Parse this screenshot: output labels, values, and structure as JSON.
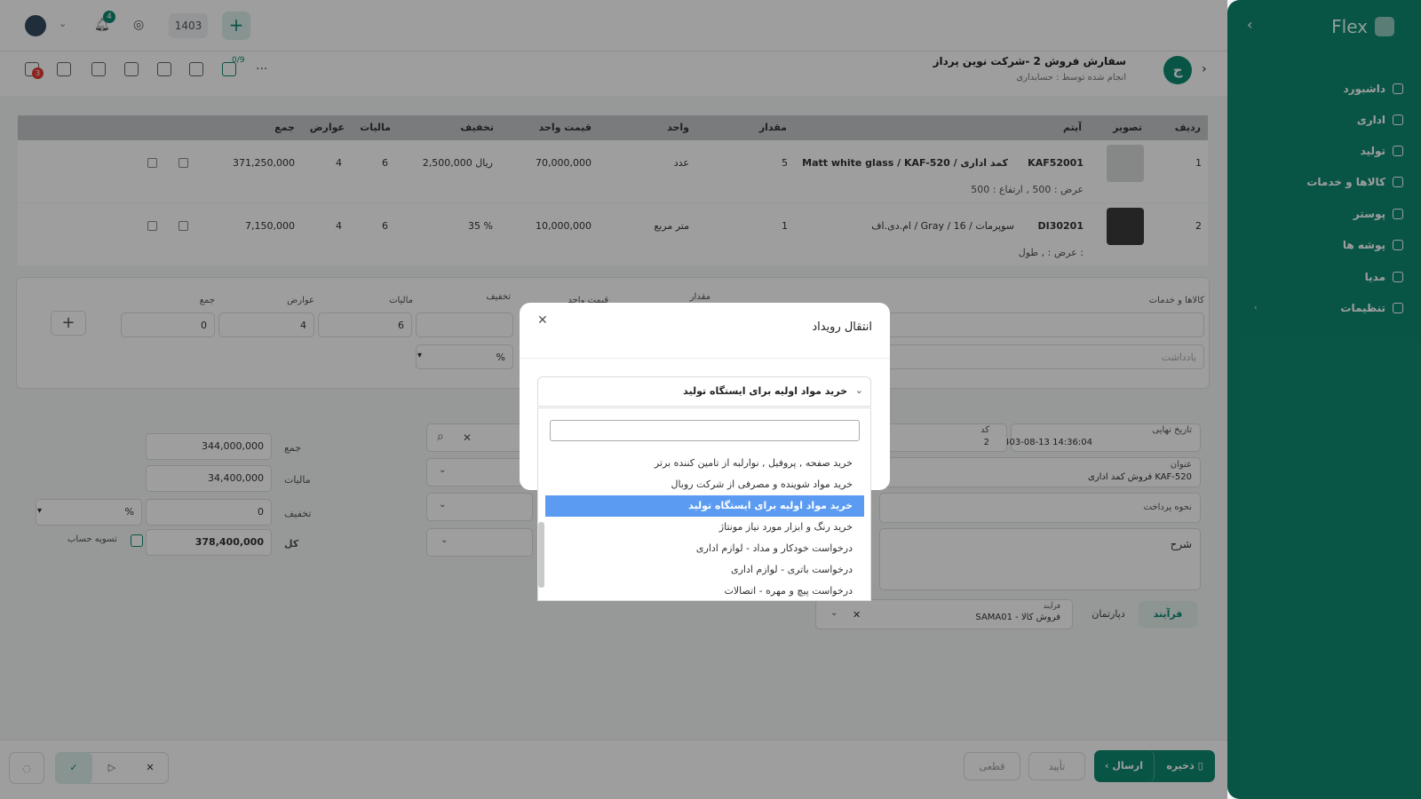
{
  "sidebar": {
    "logo": "Flex",
    "items": [
      {
        "label": "داشبورد"
      },
      {
        "label": "اداری"
      },
      {
        "label": "تولید"
      },
      {
        "label": "کالاها و خدمات"
      },
      {
        "label": "پوستر"
      },
      {
        "label": "پوشه ها"
      },
      {
        "label": "مدیا"
      },
      {
        "label": "تنظیمات"
      }
    ]
  },
  "topbar": {
    "notifications_count": "4",
    "year": "1403"
  },
  "header": {
    "title": "سفارش فروش 2 -شرکت نوین پرداز",
    "subtitle": "انجام شده توسط : حسابداری",
    "avatar_letter": "ج",
    "tool_badge": "3",
    "tool_count": "0/9"
  },
  "table": {
    "headers": {
      "row": "ردیف",
      "image": "تصویر",
      "item": "آیتم",
      "qty": "مقدار",
      "unit": "واحد",
      "unit_price": "قیمت واحد",
      "discount": "تخفیف",
      "tax": "مالیات",
      "duties": "عوارض",
      "total": "جمع"
    },
    "rows": [
      {
        "row": "1",
        "code": "KAF52001",
        "name": "Matt white glass / KAF-520 / کمد اداری",
        "dims": "عرض : 500 ,  ارتفاع : 500",
        "qty": "5",
        "unit": "عدد",
        "unit_price": "70,000,000",
        "discount": "2,500,000 ریال",
        "tax": "6",
        "duties": "4",
        "total": "371,250,000"
      },
      {
        "row": "2",
        "code": "DI30201",
        "name": "ام.دی.اف / Gray / 16 / سوپرمات",
        "dims": "عرض : ,  طول :",
        "qty": "1",
        "unit": "متر مربع",
        "unit_price": "10,000,000",
        "discount": "35 %",
        "tax": "6",
        "duties": "4",
        "total": "7,150,000"
      }
    ]
  },
  "entry": {
    "goods_label": "کالاها و خدمات",
    "qty_label": "مقدار",
    "unit_price_label": "قیمت واحد",
    "discount_label": "تخفیف",
    "tax_label": "مالیات",
    "duties_label": "عوارض",
    "total_label": "جمع",
    "tax_value": "6",
    "duties_value": "4",
    "total_value": "0",
    "percent": "%",
    "note_placeholder": "یادداشت"
  },
  "summary": {
    "sum_label": "جمع",
    "sum_value": "344,000,000",
    "tax_label": "مالیات",
    "tax_value": "34,400,000",
    "discount_label": "تخفیف",
    "discount_value": "0",
    "percent": "%",
    "total_label": "کل",
    "total_value": "378,400,000",
    "settle_label": "تسویه حساب"
  },
  "details": {
    "deadline_label": "تاریخ نهایی",
    "deadline_value": "1403-08-13 14:36:04",
    "code_label": "کد",
    "code_value": "2",
    "title_label": "عنوان",
    "title_value": "فروش کمد اداری KAF-520",
    "payment_label": "نحوه پرداخت",
    "description_label": "شرح",
    "process_tab": "فرآیند",
    "department_tab": "دپارتمان",
    "process_field_label": "فرآیند",
    "process_field_value": "SAMA01 - فروش کالا"
  },
  "footer": {
    "save": "ذخیره",
    "send": "ارسال",
    "approve": "تأیید",
    "final": "قطعی"
  },
  "modal": {
    "title": "انتقال رویداد",
    "selected": "خرید مواد اولیه برای ایستگاه تولید",
    "search_placeholder": "",
    "options": [
      "خرید صفحه , پروفیل , نوارلبه از تامین کننده برتر",
      "خرید مواد شوینده و مصرفی از شرکت روبال",
      "خرید مواد اولیه برای ایستگاه تولید",
      "خرید رنگ و ابزار مورد نیاز مونتاژ",
      "درخواست خودکار و مداد - لوازم اداری",
      "درخواست باتری - لوازم اداری",
      "درخواست پیچ و مهره - اتصالات"
    ]
  }
}
